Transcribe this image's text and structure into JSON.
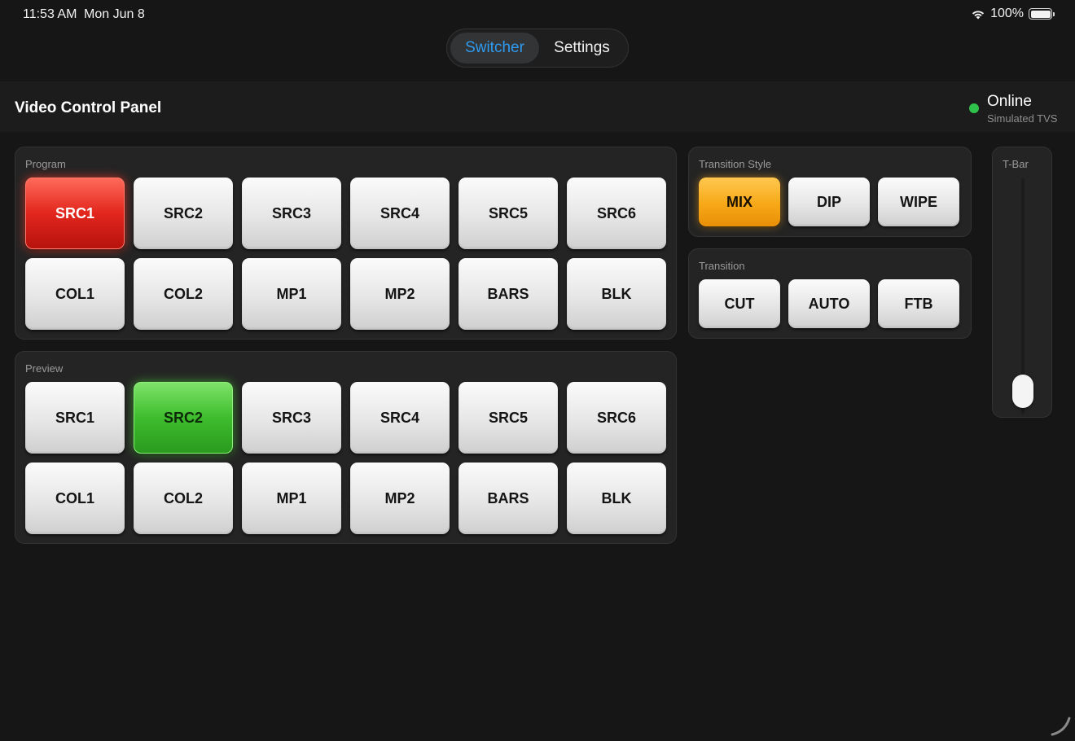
{
  "status_bar": {
    "time": "11:53 AM",
    "date": "Mon Jun 8",
    "battery": "100%",
    "icons": [
      "wifi-icon",
      "battery-icon"
    ]
  },
  "nav": {
    "tabs": [
      {
        "label": "Switcher",
        "active": true
      },
      {
        "label": "Settings",
        "active": false
      }
    ]
  },
  "header": {
    "title": "Video Control Panel",
    "status": "Online",
    "status_color": "#2fc24a",
    "device": "Simulated TVS"
  },
  "program": {
    "label": "Program",
    "active": "SRC1",
    "active_color": "#e2261d",
    "buttons": [
      "SRC1",
      "SRC2",
      "SRC3",
      "SRC4",
      "SRC5",
      "SRC6",
      "COL1",
      "COL2",
      "MP1",
      "MP2",
      "BARS",
      "BLK"
    ]
  },
  "preview": {
    "label": "Preview",
    "active": "SRC2",
    "active_color": "#3ebd2d",
    "buttons": [
      "SRC1",
      "SRC2",
      "SRC3",
      "SRC4",
      "SRC5",
      "SRC6",
      "COL1",
      "COL2",
      "MP1",
      "MP2",
      "BARS",
      "BLK"
    ]
  },
  "transition_style": {
    "label": "Transition Style",
    "active": "MIX",
    "active_color": "#f7a817",
    "buttons": [
      "MIX",
      "DIP",
      "WIPE"
    ]
  },
  "transition": {
    "label": "Transition",
    "buttons": [
      "CUT",
      "AUTO",
      "FTB"
    ]
  },
  "tbar": {
    "label": "T-Bar",
    "position": 0
  }
}
